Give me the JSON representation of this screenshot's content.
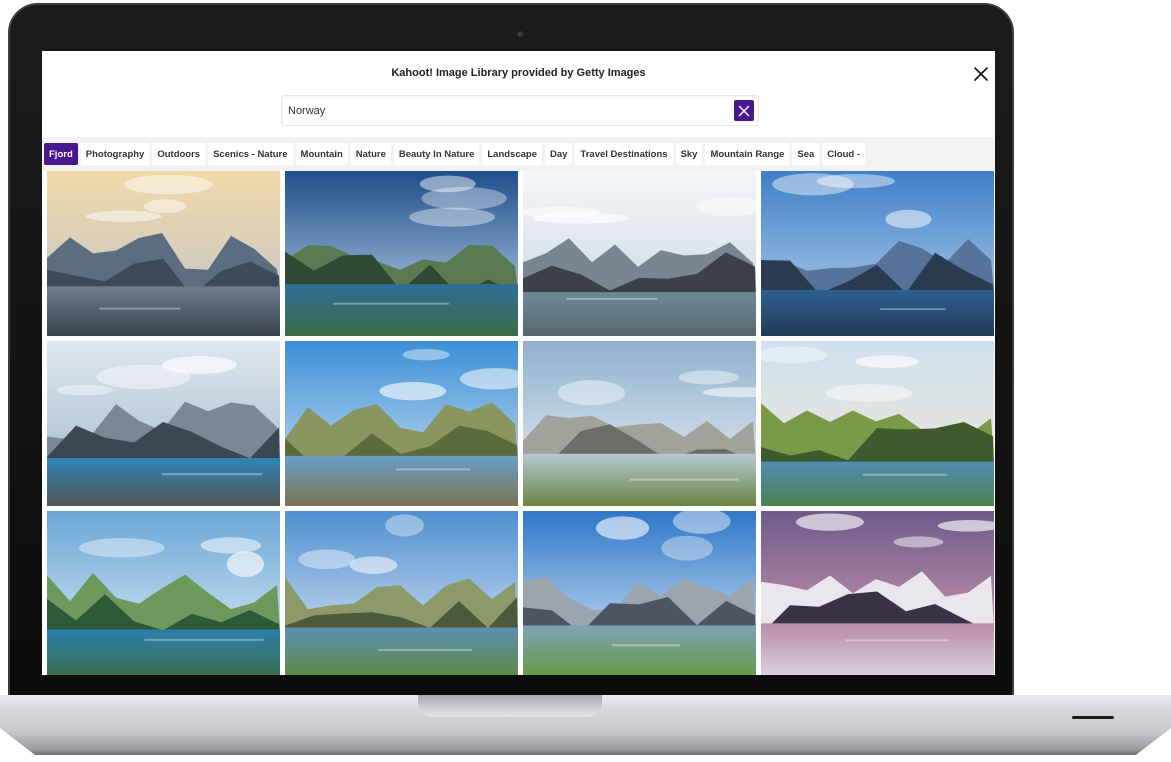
{
  "dialog": {
    "title": "Kahoot! Image Library provided by Getty Images"
  },
  "search": {
    "value": "Norway",
    "placeholder": ""
  },
  "colors": {
    "accent": "#46178f",
    "tag_bar_bg": "#f2f2f2"
  },
  "icons": {
    "close": "close-icon",
    "clear_search": "clear-search-icon",
    "camera": "camera-icon"
  },
  "tags": [
    {
      "label": "Fjord",
      "active": true
    },
    {
      "label": "Photography",
      "active": false
    },
    {
      "label": "Outdoors",
      "active": false
    },
    {
      "label": "Scenics - Nature",
      "active": false
    },
    {
      "label": "Mountain",
      "active": false
    },
    {
      "label": "Nature",
      "active": false
    },
    {
      "label": "Beauty In Nature",
      "active": false
    },
    {
      "label": "Landscape",
      "active": false
    },
    {
      "label": "Day",
      "active": false
    },
    {
      "label": "Travel Destinations",
      "active": false
    },
    {
      "label": "Sky",
      "active": false
    },
    {
      "label": "Mountain Range",
      "active": false
    },
    {
      "label": "Sea",
      "active": false
    },
    {
      "label": "Cloud -",
      "active": false
    }
  ],
  "images": [
    {
      "name": "misty-fjord-sunrise",
      "sky": "#f3d9a8",
      "sky2": "#b9c3cf",
      "mountain": "#3d4a5a",
      "mountain2": "#5d6d80",
      "water": "#6e7c8c",
      "ground": "#2c3540"
    },
    {
      "name": "lofoten-village-aerial",
      "sky": "#1e4f8c",
      "sky2": "#c9dcef",
      "mountain": "#2f4a32",
      "mountain2": "#5a7b52",
      "water": "#2f6e9a",
      "ground": "#3e6b3a"
    },
    {
      "name": "fjord-sunbeams",
      "sky": "#f4f6f8",
      "sky2": "#c6d4e0",
      "mountain": "#3b4147",
      "mountain2": "#79868f",
      "water": "#6d8a99",
      "ground": "#4f5b62"
    },
    {
      "name": "lofoten-peaks-lake",
      "sky": "#3f7fc7",
      "sky2": "#bcd7ef",
      "mountain": "#2a3a4f",
      "mountain2": "#56739a",
      "water": "#2d5f93",
      "ground": "#1f2f45"
    },
    {
      "name": "trolltunga-cliff",
      "sky": "#dfe7ee",
      "sky2": "#9db5c9",
      "mountain": "#3a4652",
      "mountain2": "#7b8794",
      "water": "#2f86b8",
      "ground": "#5a4a3a"
    },
    {
      "name": "reine-red-cabin",
      "sky": "#3d8fd6",
      "sky2": "#d7e8f6",
      "mountain": "#5b6b3b",
      "mountain2": "#8a9660",
      "water": "#6aa0c9",
      "ground": "#7c6a3a"
    },
    {
      "name": "mountain-valley-clouds",
      "sky": "#8fb1cf",
      "sky2": "#eef2f5",
      "mountain": "#6b6e68",
      "mountain2": "#9fa39a",
      "water": "#b7c9d3",
      "ground": "#5e7a2c"
    },
    {
      "name": "geirangerfjord-valley",
      "sky": "#cfe0ef",
      "sky2": "#f2e9d2",
      "mountain": "#3f5a2c",
      "mountain2": "#7a9a4a",
      "water": "#4f8db2",
      "ground": "#4c7a2a"
    },
    {
      "name": "green-fjord-aerial",
      "sky": "#6aa6d6",
      "sky2": "#e6f0f7",
      "mountain": "#2e5a3a",
      "mountain2": "#6c9a5c",
      "water": "#2c7fae",
      "ground": "#3b6a2e"
    },
    {
      "name": "lofoten-rorbu-lake",
      "sky": "#4f8fd0",
      "sky2": "#e6eef6",
      "mountain": "#4a5a3a",
      "mountain2": "#8c9a6a",
      "water": "#5b8fb3",
      "ground": "#5e8a2a"
    },
    {
      "name": "peaks-green-meadow",
      "sky": "#2f77c8",
      "sky2": "#e3eef8",
      "mountain": "#4b5660",
      "mountain2": "#9aa5ae",
      "water": "#7fa2b8",
      "ground": "#5e9a30"
    },
    {
      "name": "hamnoy-winter-dusk",
      "sky": "#6d5a8a",
      "sky2": "#e3a7b8",
      "mountain": "#3a3346",
      "mountain2": "#e9e6ee",
      "water": "#b88aa6",
      "ground": "#dedbe6"
    }
  ]
}
